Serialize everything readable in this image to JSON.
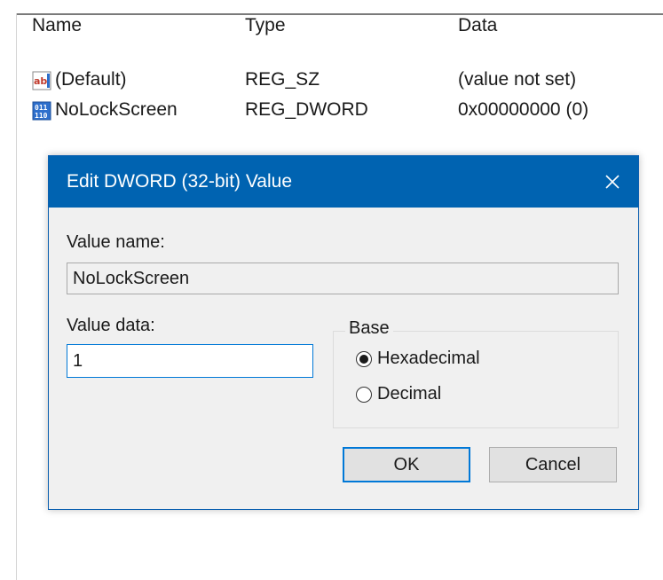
{
  "list": {
    "columns": {
      "name": "Name",
      "type": "Type",
      "data": "Data"
    },
    "rows": [
      {
        "icon": "string-value-icon",
        "name": "(Default)",
        "type": "REG_SZ",
        "data": "(value not set)"
      },
      {
        "icon": "binary-value-icon",
        "name": "NoLockScreen",
        "type": "REG_DWORD",
        "data": "0x00000000 (0)"
      }
    ]
  },
  "dialog": {
    "title": "Edit DWORD (32-bit) Value",
    "value_name_label": "Value name:",
    "value_name": "NoLockScreen",
    "value_data_label": "Value data:",
    "value_data": "1",
    "base_label": "Base",
    "base_options": [
      {
        "label": "Hexadecimal",
        "selected": true
      },
      {
        "label": "Decimal",
        "selected": false
      }
    ],
    "ok_label": "OK",
    "cancel_label": "Cancel"
  },
  "colors": {
    "titlebar": "#0063b1",
    "focus": "#0078d7",
    "dialog_bg": "#f0f0f0"
  }
}
